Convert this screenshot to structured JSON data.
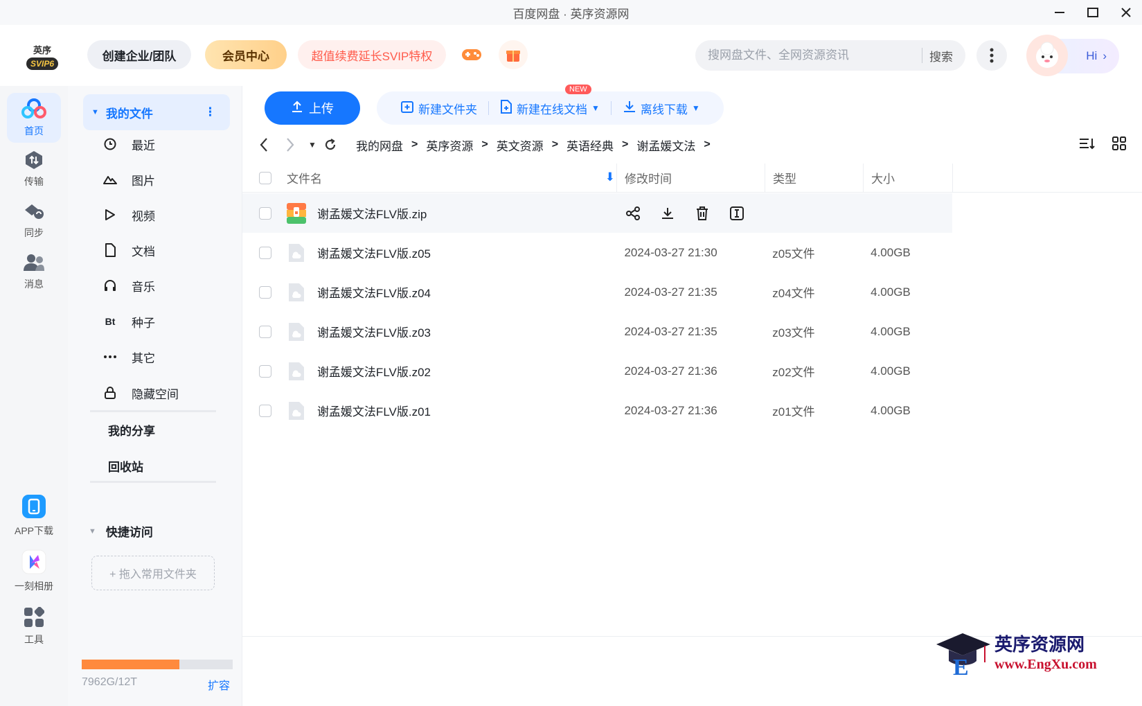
{
  "window": {
    "title": "百度网盘 · 英序资源网"
  },
  "header": {
    "logo_text": "英序",
    "logo_badge": "SVIP6",
    "team_label": "创建企业/团队",
    "vip_label": "会员中心",
    "svip_label": "超值续费延长SVIP特权",
    "search_placeholder": "搜网盘文件、全网资源资讯",
    "search_button": "搜索",
    "hi_label": "Hi"
  },
  "rail": {
    "items": [
      {
        "label": "首页",
        "icon": "home-icon"
      },
      {
        "label": "传输",
        "icon": "transfer-icon"
      },
      {
        "label": "同步",
        "icon": "sync-icon"
      },
      {
        "label": "消息",
        "icon": "message-icon"
      }
    ],
    "bottom": [
      {
        "label": "APP下载",
        "icon": "phone-icon"
      },
      {
        "label": "一刻相册",
        "icon": "album-icon"
      },
      {
        "label": "工具",
        "icon": "tools-icon"
      }
    ]
  },
  "sidebar": {
    "my_files": "我的文件",
    "items": [
      {
        "label": "最近",
        "icon": "clock-icon"
      },
      {
        "label": "图片",
        "icon": "image-icon"
      },
      {
        "label": "视频",
        "icon": "video-icon"
      },
      {
        "label": "文档",
        "icon": "document-icon"
      },
      {
        "label": "音乐",
        "icon": "music-icon"
      },
      {
        "label": "种子",
        "icon": "bt-icon"
      },
      {
        "label": "其它",
        "icon": "more-dots-icon"
      },
      {
        "label": "隐藏空间",
        "icon": "lock-icon"
      }
    ],
    "my_share": "我的分享",
    "recycle": "回收站",
    "quick_access": "快捷访问",
    "drop_hint": "+ 拖入常用文件夹",
    "quota_text": "7962G/12T",
    "quota_fraction": 0.648,
    "expand": "扩容",
    "bt_glyph": "Bt"
  },
  "toolbar": {
    "upload": "上传",
    "new_folder": "新建文件夹",
    "new_doc": "新建在线文档",
    "new_badge": "NEW",
    "offline": "离线下载"
  },
  "breadcrumb": [
    "我的网盘",
    "英序资源",
    "英文资源",
    "英语经典",
    "谢孟媛文法"
  ],
  "table": {
    "headers": {
      "name": "文件名",
      "time": "修改时间",
      "type": "类型",
      "size": "大小"
    },
    "rows": [
      {
        "name": "谢孟媛文法FLV版.zip",
        "time": "",
        "type": "",
        "size": ""
      },
      {
        "name": "谢孟媛文法FLV版.z05",
        "time": "2024-03-27 21:30",
        "type": "z05文件",
        "size": "4.00GB"
      },
      {
        "name": "谢孟媛文法FLV版.z04",
        "time": "2024-03-27 21:35",
        "type": "z04文件",
        "size": "4.00GB"
      },
      {
        "name": "谢孟媛文法FLV版.z03",
        "time": "2024-03-27 21:35",
        "type": "z03文件",
        "size": "4.00GB"
      },
      {
        "name": "谢孟媛文法FLV版.z02",
        "time": "2024-03-27 21:36",
        "type": "z02文件",
        "size": "4.00GB"
      },
      {
        "name": "谢孟媛文法FLV版.z01",
        "time": "2024-03-27 21:36",
        "type": "z01文件",
        "size": "4.00GB"
      }
    ]
  },
  "watermark": {
    "cn": "英序资源网",
    "url": "www.EngXu.com"
  },
  "colors": {
    "accent": "#1677ff",
    "quota": "#ff8a3d"
  }
}
